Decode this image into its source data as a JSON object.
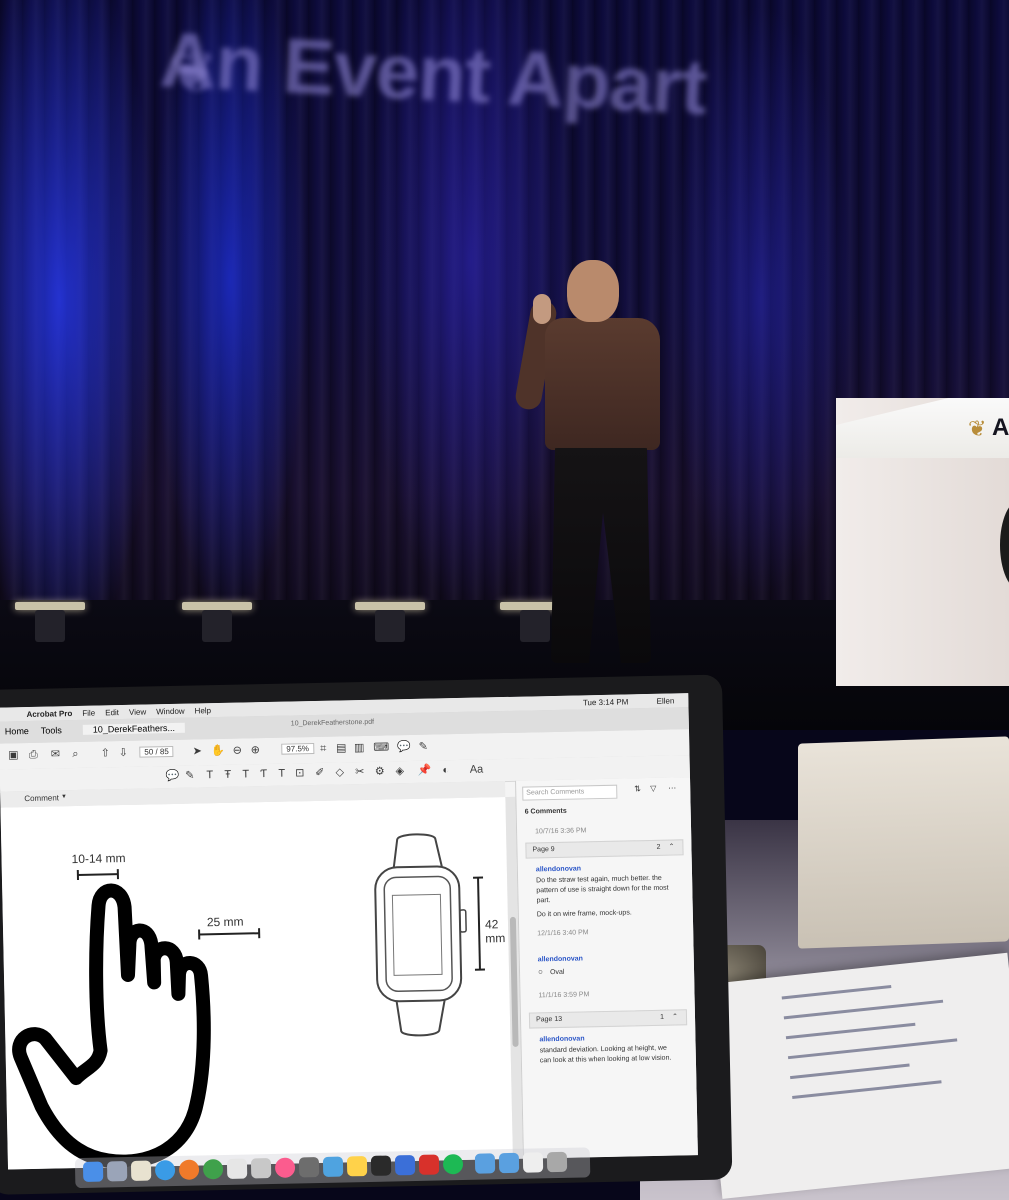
{
  "backdrop": {
    "banner_text": "An Event Apart",
    "podium_text": "A"
  },
  "acrobat": {
    "menubar": {
      "app_name": "Acrobat Pro",
      "menus": [
        "File",
        "Edit",
        "View",
        "Window",
        "Help"
      ],
      "clock": "Tue 3:14 PM",
      "user": "Ellen"
    },
    "tabs": {
      "home": "Home",
      "tools": "Tools",
      "doc_tab": "10_DerekFeathers...",
      "window_title": "10_DerekFeatherstone.pdf"
    },
    "toolbar": {
      "page_current": "50",
      "page_total": "/ 85",
      "zoom": "97.5%"
    },
    "comment_label": "Comment",
    "document": {
      "finger_width": "10-14 mm",
      "touch_target": "25 mm",
      "watch_height": "42 mm"
    },
    "comments_panel": {
      "search_placeholder": "Search Comments",
      "count": "6 Comments",
      "timestamp1": "10/7/16 3:36 PM",
      "page1": "Page 9",
      "page1_count": "2",
      "author1": "allendonovan",
      "comment1": "Do the straw test again, much better. the pattern of use is straight down for the most part.",
      "comment1b": "Do it on wire frame, mock-ups.",
      "timestamp2": "12/1/16 3:40 PM",
      "author2": "allendonovan",
      "comment2": "Oval",
      "timestamp3": "11/1/16 3:59 PM",
      "page2": "Page 13",
      "page2_count": "1",
      "author3": "allendonovan",
      "comment3": "standard deviation. Looking at height, we can look at this when looking at low vision."
    }
  }
}
